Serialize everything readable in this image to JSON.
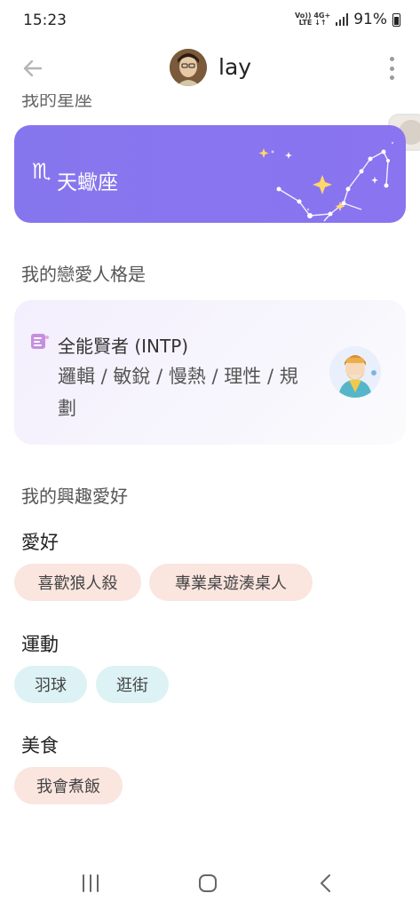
{
  "status_bar": {
    "time": "15:23",
    "network_label_top": "Vo)) 4G+",
    "network_label_bottom": "LTE ↓↑",
    "battery": "91%"
  },
  "header": {
    "name": "lay",
    "avatar_icon": "user-avatar",
    "back_icon": "arrow-left-icon",
    "more_icon": "more-vertical-icon"
  },
  "cut_section_title": "我的星座",
  "zodiac": {
    "symbol": "♏",
    "name": "天蠍座",
    "background": "#8676ee"
  },
  "personality": {
    "section_title": "我的戀愛人格是",
    "type_name": "全能賢者 (INTP)",
    "traits": "邏輯 / 敏銳 / 慢熱 / 理性 / 規劃"
  },
  "interests": {
    "section_title": "我的興趣愛好",
    "groups": [
      {
        "title": "愛好",
        "tags": [
          "喜歡狼人殺",
          "專業桌遊湊桌人"
        ]
      },
      {
        "title": "運動",
        "tags": [
          "羽球",
          "逛街"
        ]
      },
      {
        "title": "美食",
        "tags": [
          "我會煮飯"
        ]
      }
    ]
  },
  "colors": {
    "accent_purple": "#8676ee",
    "tag_peach": "#fae5df",
    "tag_mint": "#ddf2f5"
  }
}
